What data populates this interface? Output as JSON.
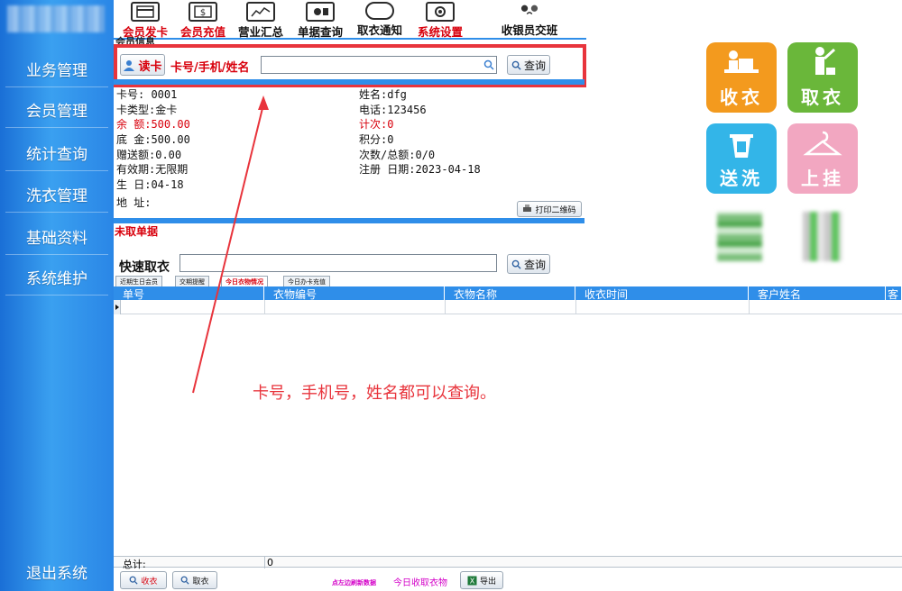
{
  "sidebar": {
    "items": [
      {
        "label": "业务管理"
      },
      {
        "label": "会员管理"
      },
      {
        "label": "统计查询"
      },
      {
        "label": "洗衣管理"
      },
      {
        "label": "基础资料"
      },
      {
        "label": "系统维护"
      }
    ],
    "exit_label": "退出系统"
  },
  "toolbar": {
    "items": [
      {
        "label": "会员发卡",
        "icon": "card-icon",
        "color": "#d8000c"
      },
      {
        "label": "会员充值",
        "icon": "money-icon",
        "color": "#d8000c"
      },
      {
        "label": "营业汇总",
        "icon": "chart-icon",
        "color": "#111111"
      },
      {
        "label": "单据查询",
        "icon": "document-icon",
        "color": "#111111"
      },
      {
        "label": "取衣通知",
        "icon": "message-icon",
        "color": "#111111"
      },
      {
        "label": "系统设置",
        "icon": "settings-icon",
        "color": "#d8000c"
      },
      {
        "label": "收银员交班",
        "icon": "handover-icon",
        "color": "#111111"
      }
    ]
  },
  "search": {
    "section_label": "会员信息",
    "read_card": "读卡",
    "field_label": "卡号/手机/姓名",
    "input_value": "",
    "query_button": "查询"
  },
  "member": {
    "card_no": "卡号: 0001",
    "card_type": "卡类型:金卡",
    "balance": "余 额:500.00",
    "base_amount": "底 金:500.00",
    "gift_amount": "赠送额:0.00",
    "validity": "有效期:无限期",
    "birthday": "生 日:04-18",
    "address": "地 址:",
    "name": "姓名:dfg",
    "phone": "电话:123456",
    "count": "计次:0",
    "points": "积分:0",
    "times": "次数/总额:0/0",
    "register": "注册 日期:2023-04-18",
    "print_qr": "打印二维码"
  },
  "unpicked": {
    "label": "未取单据"
  },
  "quick_pick": {
    "label": "快速取衣",
    "value": "",
    "query_button": "查询"
  },
  "tiles": [
    {
      "label": "收衣",
      "color": "#f39a1e",
      "icon": "receive-clothes-icon"
    },
    {
      "label": "取衣",
      "color": "#6ab73a",
      "icon": "pickup-clothes-icon"
    },
    {
      "label": "送洗",
      "color": "#33b5e8",
      "icon": "wash-icon"
    },
    {
      "label": "上挂",
      "color": "#f2a7c1",
      "icon": "hanger-icon"
    }
  ],
  "tabs": [
    {
      "label": "近期生日会员"
    },
    {
      "label": "交期提醒"
    },
    {
      "label": "今日衣物情况"
    },
    {
      "label": "今日办卡充值"
    }
  ],
  "table": {
    "columns": [
      "单号",
      "衣物编号",
      "衣物名称",
      "收衣时间",
      "客户姓名",
      "客"
    ]
  },
  "footer": {
    "total_label": "总计:",
    "total_value": "0",
    "receive_button": "收衣",
    "pickup_button": "取衣",
    "refresh_hint": "点左边刷新数据",
    "today_received": "今日收取衣物",
    "export_button": "导出"
  },
  "annotation": {
    "text": "卡号，手机号，姓名都可以查询。"
  }
}
